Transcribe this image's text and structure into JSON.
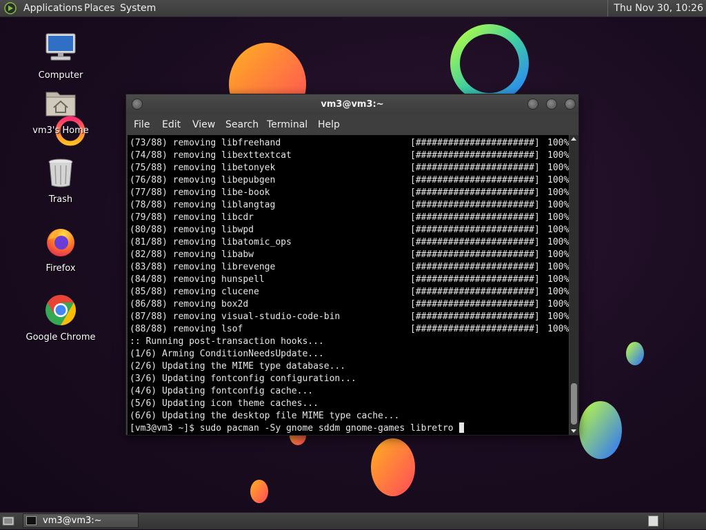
{
  "top_panel": {
    "menus": [
      "Applications",
      "Places",
      "System"
    ],
    "clock": "Thu Nov 30, 10:26"
  },
  "desktop_icons": [
    {
      "label": "Computer",
      "icon": "computer-icon"
    },
    {
      "label": "vm3's Home",
      "icon": "home-folder-icon"
    },
    {
      "label": "Trash",
      "icon": "trash-icon"
    },
    {
      "label": "Firefox",
      "icon": "firefox-icon"
    },
    {
      "label": "Google Chrome",
      "icon": "chrome-icon"
    }
  ],
  "terminal": {
    "title": "vm3@vm3:~",
    "menus": [
      "File",
      "Edit",
      "View",
      "Search",
      "Terminal",
      "Help"
    ],
    "progress_lines": [
      {
        "text": "(73/88) removing libfreehand",
        "bar": "[######################]",
        "pct": "100%"
      },
      {
        "text": "(74/88) removing libexttextcat",
        "bar": "[######################]",
        "pct": "100%"
      },
      {
        "text": "(75/88) removing libetonyek",
        "bar": "[######################]",
        "pct": "100%"
      },
      {
        "text": "(76/88) removing libepubgen",
        "bar": "[######################]",
        "pct": "100%"
      },
      {
        "text": "(77/88) removing libe-book",
        "bar": "[######################]",
        "pct": "100%"
      },
      {
        "text": "(78/88) removing liblangtag",
        "bar": "[######################]",
        "pct": "100%"
      },
      {
        "text": "(79/88) removing libcdr",
        "bar": "[######################]",
        "pct": "100%"
      },
      {
        "text": "(80/88) removing libwpd",
        "bar": "[######################]",
        "pct": "100%"
      },
      {
        "text": "(81/88) removing libatomic_ops",
        "bar": "[######################]",
        "pct": "100%"
      },
      {
        "text": "(82/88) removing libabw",
        "bar": "[######################]",
        "pct": "100%"
      },
      {
        "text": "(83/88) removing librevenge",
        "bar": "[######################]",
        "pct": "100%"
      },
      {
        "text": "(84/88) removing hunspell",
        "bar": "[######################]",
        "pct": "100%"
      },
      {
        "text": "(85/88) removing clucene",
        "bar": "[######################]",
        "pct": "100%"
      },
      {
        "text": "(86/88) removing box2d",
        "bar": "[######################]",
        "pct": "100%"
      },
      {
        "text": "(87/88) removing visual-studio-code-bin",
        "bar": "[######################]",
        "pct": "100%"
      },
      {
        "text": "(88/88) removing lsof",
        "bar": "[######################]",
        "pct": "100%"
      }
    ],
    "hook_lines": [
      ":: Running post-transaction hooks...",
      "(1/6) Arming ConditionNeedsUpdate...",
      "(2/6) Updating the MIME type database...",
      "(3/6) Updating fontconfig configuration...",
      "(4/6) Updating fontconfig cache...",
      "(5/6) Updating icon theme caches...",
      "(6/6) Updating the desktop file MIME type cache..."
    ],
    "prompt": "[vm3@vm3 ~]$ sudo pacman -Sy gnome sddm gnome-games libretro "
  },
  "taskbar": {
    "window_button": "vm3@vm3:~"
  },
  "colors": {
    "background": "#1a0c20",
    "panel": "#3a3a3a",
    "terminal_bg": "#000000",
    "terminal_fg": "#e6e6e6"
  }
}
